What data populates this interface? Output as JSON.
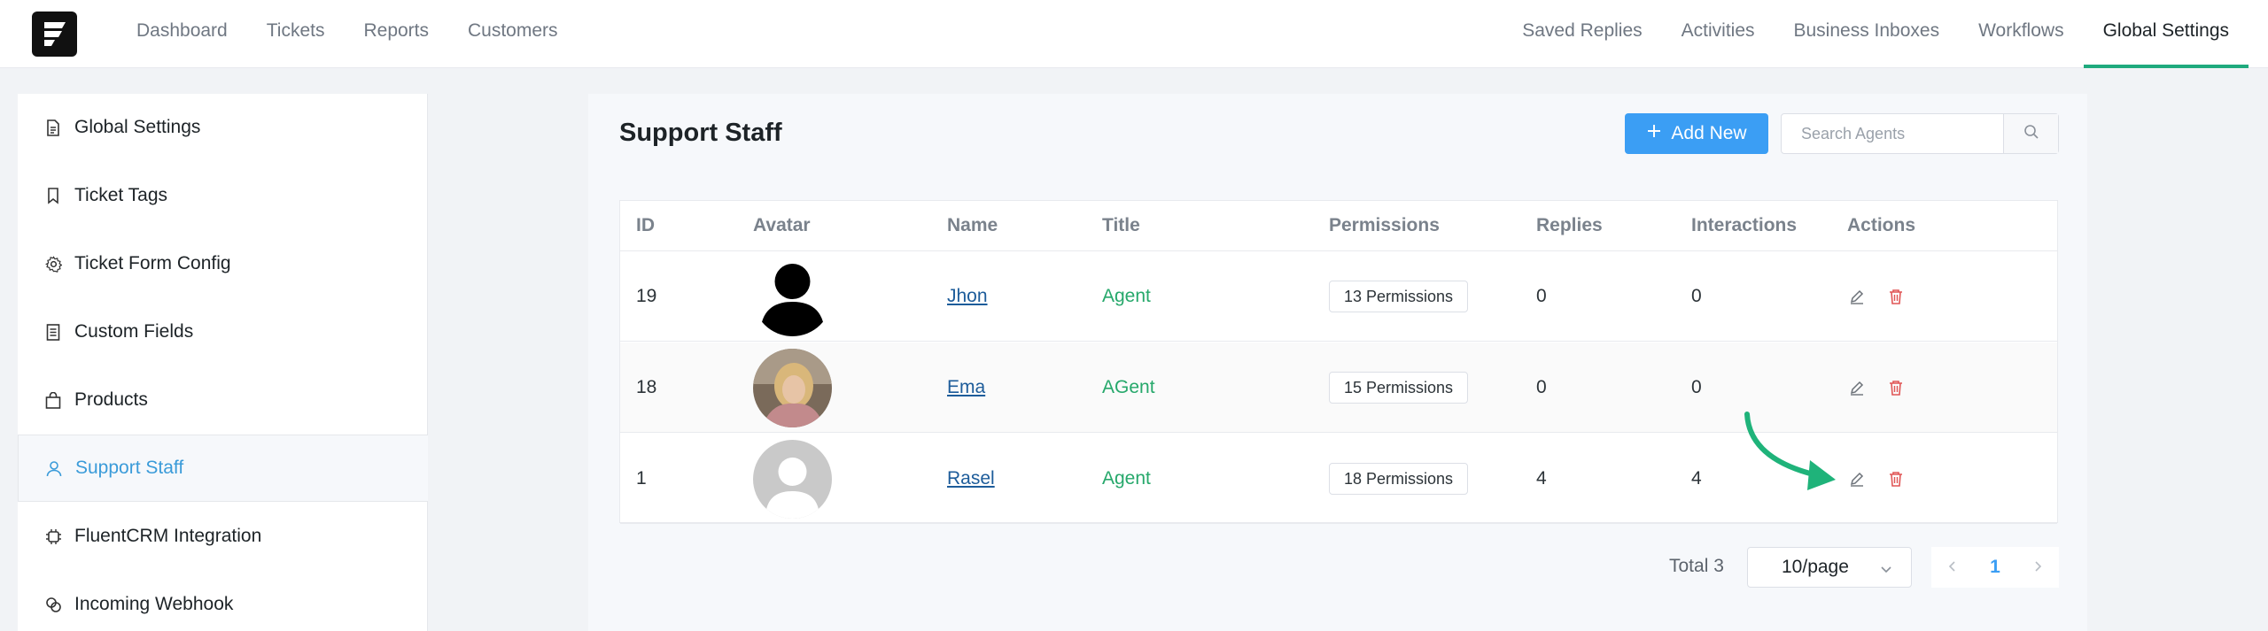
{
  "nav_left": [
    "Dashboard",
    "Tickets",
    "Reports",
    "Customers"
  ],
  "nav_right": [
    "Saved Replies",
    "Activities",
    "Business Inboxes",
    "Workflows",
    "Global Settings"
  ],
  "nav_active": "Global Settings",
  "sidebar": {
    "items": [
      {
        "label": "Global Settings",
        "icon": "document-icon"
      },
      {
        "label": "Ticket Tags",
        "icon": "bookmark-icon"
      },
      {
        "label": "Ticket Form Config",
        "icon": "gear-icon"
      },
      {
        "label": "Custom Fields",
        "icon": "list-document-icon"
      },
      {
        "label": "Products",
        "icon": "bag-icon"
      },
      {
        "label": "Support Staff",
        "icon": "user-icon"
      },
      {
        "label": "FluentCRM Integration",
        "icon": "chip-icon"
      },
      {
        "label": "Incoming Webhook",
        "icon": "webhook-icon"
      }
    ],
    "active": "Support Staff"
  },
  "main": {
    "title": "Support Staff",
    "add_label": "Add New",
    "search_placeholder": "Search Agents"
  },
  "table": {
    "columns": [
      "ID",
      "Avatar",
      "Name",
      "Title",
      "Permissions",
      "Replies",
      "Interactions",
      "Actions"
    ],
    "rows": [
      {
        "id": "19",
        "name": "Jhon",
        "title": "Agent",
        "permissions": "13 Permissions",
        "replies": "0",
        "interactions": "0",
        "avatar": "silhouette"
      },
      {
        "id": "18",
        "name": "Ema",
        "title": "AGent",
        "permissions": "15 Permissions",
        "replies": "0",
        "interactions": "0",
        "avatar": "photo"
      },
      {
        "id": "1",
        "name": "Rasel",
        "title": "Agent",
        "permissions": "18 Permissions",
        "replies": "4",
        "interactions": "4",
        "avatar": "default"
      }
    ]
  },
  "pagination": {
    "total": "Total 3",
    "page_size": "10/page",
    "current_page": "1"
  },
  "colors": {
    "accent_green": "#1faa7d",
    "primary_blue": "#3b9ef4",
    "title_green": "#26a86b",
    "delete_red": "#e05555"
  }
}
